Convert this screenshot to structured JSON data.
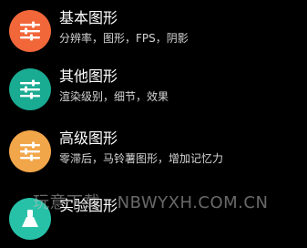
{
  "colors": {
    "background": "#000000",
    "basic": "#f2673a",
    "other": "#1aab93",
    "advanced": "#f2a64a",
    "experimental": "#27c1a8"
  },
  "items": [
    {
      "title": "基本图形",
      "subtitle": "分辨率，图形，FPS，阴影",
      "icon": "sliders-icon"
    },
    {
      "title": "其他图形",
      "subtitle": "渲染级别，细节，效果",
      "icon": "sliders-icon"
    },
    {
      "title": "高级图形",
      "subtitle": "零滞后，马铃薯图形，增加记忆力",
      "icon": "sliders-icon"
    },
    {
      "title": "实验图形",
      "subtitle": "",
      "icon": "flask-icon"
    }
  ],
  "watermark": "玩意下载 · NBWYXH.COM.CN"
}
